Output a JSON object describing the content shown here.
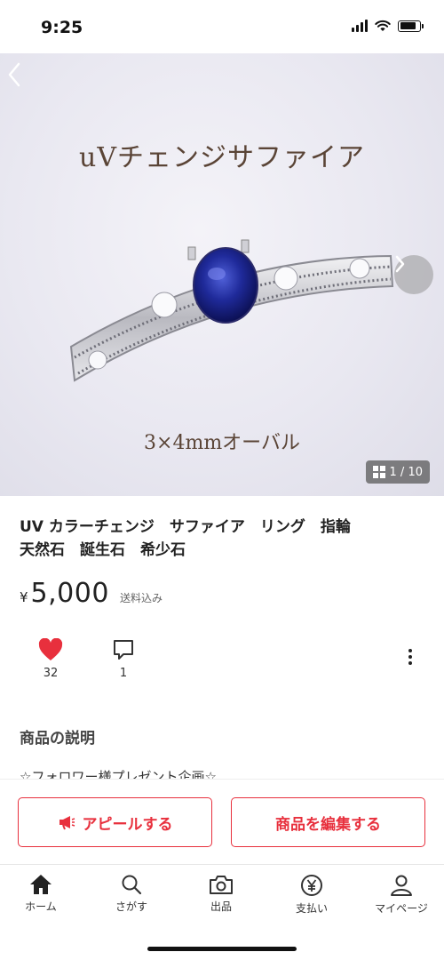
{
  "status_bar": {
    "time": "9:25",
    "battery_level": 0.85
  },
  "gallery": {
    "overlay_title": "uVチェンジサファイア",
    "overlay_caption": "3×4mmオーバル",
    "counter": "1 / 10"
  },
  "item": {
    "title_line1": "UV カラーチェンジ　サファイア　リング　指輪",
    "title_line2": "天然石　誕生石　希少石",
    "currency": "¥",
    "price": "5,000",
    "shipping": "送料込み"
  },
  "actions": {
    "likes": "32",
    "comments": "1"
  },
  "description": {
    "heading": "商品の説明",
    "preview": "☆フォロワー様プレゼント企画☆"
  },
  "cta": {
    "appeal": "アピールする",
    "edit": "商品を編集する"
  },
  "tabs": [
    {
      "label": "ホーム",
      "icon": "home-icon"
    },
    {
      "label": "さがす",
      "icon": "search-icon"
    },
    {
      "label": "出品",
      "icon": "camera-icon"
    },
    {
      "label": "支払い",
      "icon": "yen-icon"
    },
    {
      "label": "マイページ",
      "icon": "person-icon"
    }
  ],
  "colors": {
    "accent": "#e8303d",
    "like": "#e8303d"
  }
}
